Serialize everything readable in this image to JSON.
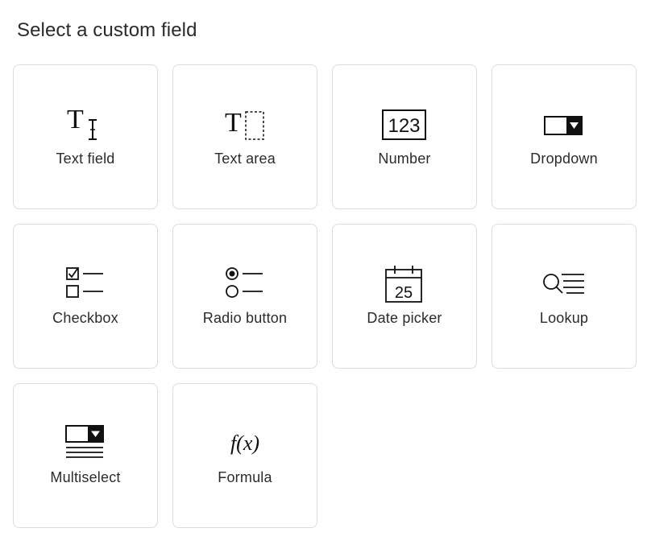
{
  "header": {
    "title": "Select a custom field"
  },
  "fields": [
    {
      "label": "Text field",
      "icon": "text-field-icon"
    },
    {
      "label": "Text area",
      "icon": "text-area-icon"
    },
    {
      "label": "Number",
      "icon": "number-icon",
      "icon_text": "123"
    },
    {
      "label": "Dropdown",
      "icon": "dropdown-icon"
    },
    {
      "label": "Checkbox",
      "icon": "checkbox-icon"
    },
    {
      "label": "Radio button",
      "icon": "radio-button-icon"
    },
    {
      "label": "Date picker",
      "icon": "date-picker-icon",
      "icon_text": "25"
    },
    {
      "label": "Lookup",
      "icon": "lookup-icon"
    },
    {
      "label": "Multiselect",
      "icon": "multiselect-icon"
    },
    {
      "label": "Formula",
      "icon": "formula-icon",
      "icon_text": "f(x)"
    }
  ]
}
